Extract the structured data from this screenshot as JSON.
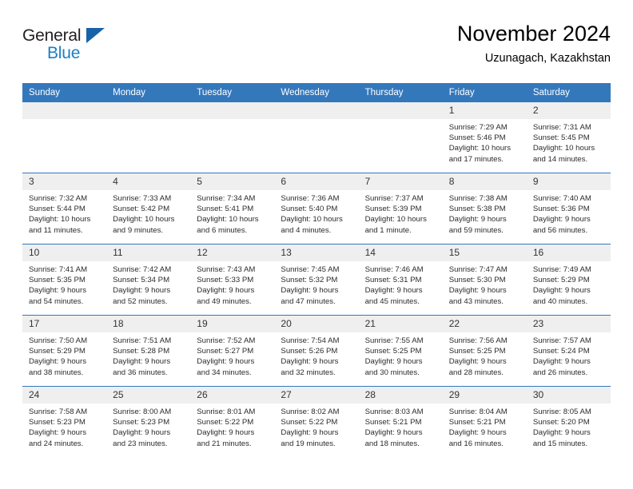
{
  "brand": {
    "name_part1": "General",
    "name_part2": "Blue",
    "triangle_color": "#1663a8",
    "blue_text_color": "#1c7fc4"
  },
  "header": {
    "title": "November 2024",
    "subtitle": "Uzunagach, Kazakhstan"
  },
  "theme": {
    "header_row_bg": "#3478bc",
    "daynum_bg": "#efefef",
    "grid_line": "#3478bc",
    "text": "#2b2b2b"
  },
  "weekdays": [
    "Sunday",
    "Monday",
    "Tuesday",
    "Wednesday",
    "Thursday",
    "Friday",
    "Saturday"
  ],
  "weeks": [
    [
      {
        "day": "",
        "sunrise": "",
        "sunset": "",
        "daylight_line1": "",
        "daylight_line2": ""
      },
      {
        "day": "",
        "sunrise": "",
        "sunset": "",
        "daylight_line1": "",
        "daylight_line2": ""
      },
      {
        "day": "",
        "sunrise": "",
        "sunset": "",
        "daylight_line1": "",
        "daylight_line2": ""
      },
      {
        "day": "",
        "sunrise": "",
        "sunset": "",
        "daylight_line1": "",
        "daylight_line2": ""
      },
      {
        "day": "",
        "sunrise": "",
        "sunset": "",
        "daylight_line1": "",
        "daylight_line2": ""
      },
      {
        "day": "1",
        "sunrise": "Sunrise: 7:29 AM",
        "sunset": "Sunset: 5:46 PM",
        "daylight_line1": "Daylight: 10 hours",
        "daylight_line2": "and 17 minutes."
      },
      {
        "day": "2",
        "sunrise": "Sunrise: 7:31 AM",
        "sunset": "Sunset: 5:45 PM",
        "daylight_line1": "Daylight: 10 hours",
        "daylight_line2": "and 14 minutes."
      }
    ],
    [
      {
        "day": "3",
        "sunrise": "Sunrise: 7:32 AM",
        "sunset": "Sunset: 5:44 PM",
        "daylight_line1": "Daylight: 10 hours",
        "daylight_line2": "and 11 minutes."
      },
      {
        "day": "4",
        "sunrise": "Sunrise: 7:33 AM",
        "sunset": "Sunset: 5:42 PM",
        "daylight_line1": "Daylight: 10 hours",
        "daylight_line2": "and 9 minutes."
      },
      {
        "day": "5",
        "sunrise": "Sunrise: 7:34 AM",
        "sunset": "Sunset: 5:41 PM",
        "daylight_line1": "Daylight: 10 hours",
        "daylight_line2": "and 6 minutes."
      },
      {
        "day": "6",
        "sunrise": "Sunrise: 7:36 AM",
        "sunset": "Sunset: 5:40 PM",
        "daylight_line1": "Daylight: 10 hours",
        "daylight_line2": "and 4 minutes."
      },
      {
        "day": "7",
        "sunrise": "Sunrise: 7:37 AM",
        "sunset": "Sunset: 5:39 PM",
        "daylight_line1": "Daylight: 10 hours",
        "daylight_line2": "and 1 minute."
      },
      {
        "day": "8",
        "sunrise": "Sunrise: 7:38 AM",
        "sunset": "Sunset: 5:38 PM",
        "daylight_line1": "Daylight: 9 hours",
        "daylight_line2": "and 59 minutes."
      },
      {
        "day": "9",
        "sunrise": "Sunrise: 7:40 AM",
        "sunset": "Sunset: 5:36 PM",
        "daylight_line1": "Daylight: 9 hours",
        "daylight_line2": "and 56 minutes."
      }
    ],
    [
      {
        "day": "10",
        "sunrise": "Sunrise: 7:41 AM",
        "sunset": "Sunset: 5:35 PM",
        "daylight_line1": "Daylight: 9 hours",
        "daylight_line2": "and 54 minutes."
      },
      {
        "day": "11",
        "sunrise": "Sunrise: 7:42 AM",
        "sunset": "Sunset: 5:34 PM",
        "daylight_line1": "Daylight: 9 hours",
        "daylight_line2": "and 52 minutes."
      },
      {
        "day": "12",
        "sunrise": "Sunrise: 7:43 AM",
        "sunset": "Sunset: 5:33 PM",
        "daylight_line1": "Daylight: 9 hours",
        "daylight_line2": "and 49 minutes."
      },
      {
        "day": "13",
        "sunrise": "Sunrise: 7:45 AM",
        "sunset": "Sunset: 5:32 PM",
        "daylight_line1": "Daylight: 9 hours",
        "daylight_line2": "and 47 minutes."
      },
      {
        "day": "14",
        "sunrise": "Sunrise: 7:46 AM",
        "sunset": "Sunset: 5:31 PM",
        "daylight_line1": "Daylight: 9 hours",
        "daylight_line2": "and 45 minutes."
      },
      {
        "day": "15",
        "sunrise": "Sunrise: 7:47 AM",
        "sunset": "Sunset: 5:30 PM",
        "daylight_line1": "Daylight: 9 hours",
        "daylight_line2": "and 43 minutes."
      },
      {
        "day": "16",
        "sunrise": "Sunrise: 7:49 AM",
        "sunset": "Sunset: 5:29 PM",
        "daylight_line1": "Daylight: 9 hours",
        "daylight_line2": "and 40 minutes."
      }
    ],
    [
      {
        "day": "17",
        "sunrise": "Sunrise: 7:50 AM",
        "sunset": "Sunset: 5:29 PM",
        "daylight_line1": "Daylight: 9 hours",
        "daylight_line2": "and 38 minutes."
      },
      {
        "day": "18",
        "sunrise": "Sunrise: 7:51 AM",
        "sunset": "Sunset: 5:28 PM",
        "daylight_line1": "Daylight: 9 hours",
        "daylight_line2": "and 36 minutes."
      },
      {
        "day": "19",
        "sunrise": "Sunrise: 7:52 AM",
        "sunset": "Sunset: 5:27 PM",
        "daylight_line1": "Daylight: 9 hours",
        "daylight_line2": "and 34 minutes."
      },
      {
        "day": "20",
        "sunrise": "Sunrise: 7:54 AM",
        "sunset": "Sunset: 5:26 PM",
        "daylight_line1": "Daylight: 9 hours",
        "daylight_line2": "and 32 minutes."
      },
      {
        "day": "21",
        "sunrise": "Sunrise: 7:55 AM",
        "sunset": "Sunset: 5:25 PM",
        "daylight_line1": "Daylight: 9 hours",
        "daylight_line2": "and 30 minutes."
      },
      {
        "day": "22",
        "sunrise": "Sunrise: 7:56 AM",
        "sunset": "Sunset: 5:25 PM",
        "daylight_line1": "Daylight: 9 hours",
        "daylight_line2": "and 28 minutes."
      },
      {
        "day": "23",
        "sunrise": "Sunrise: 7:57 AM",
        "sunset": "Sunset: 5:24 PM",
        "daylight_line1": "Daylight: 9 hours",
        "daylight_line2": "and 26 minutes."
      }
    ],
    [
      {
        "day": "24",
        "sunrise": "Sunrise: 7:58 AM",
        "sunset": "Sunset: 5:23 PM",
        "daylight_line1": "Daylight: 9 hours",
        "daylight_line2": "and 24 minutes."
      },
      {
        "day": "25",
        "sunrise": "Sunrise: 8:00 AM",
        "sunset": "Sunset: 5:23 PM",
        "daylight_line1": "Daylight: 9 hours",
        "daylight_line2": "and 23 minutes."
      },
      {
        "day": "26",
        "sunrise": "Sunrise: 8:01 AM",
        "sunset": "Sunset: 5:22 PM",
        "daylight_line1": "Daylight: 9 hours",
        "daylight_line2": "and 21 minutes."
      },
      {
        "day": "27",
        "sunrise": "Sunrise: 8:02 AM",
        "sunset": "Sunset: 5:22 PM",
        "daylight_line1": "Daylight: 9 hours",
        "daylight_line2": "and 19 minutes."
      },
      {
        "day": "28",
        "sunrise": "Sunrise: 8:03 AM",
        "sunset": "Sunset: 5:21 PM",
        "daylight_line1": "Daylight: 9 hours",
        "daylight_line2": "and 18 minutes."
      },
      {
        "day": "29",
        "sunrise": "Sunrise: 8:04 AM",
        "sunset": "Sunset: 5:21 PM",
        "daylight_line1": "Daylight: 9 hours",
        "daylight_line2": "and 16 minutes."
      },
      {
        "day": "30",
        "sunrise": "Sunrise: 8:05 AM",
        "sunset": "Sunset: 5:20 PM",
        "daylight_line1": "Daylight: 9 hours",
        "daylight_line2": "and 15 minutes."
      }
    ]
  ]
}
